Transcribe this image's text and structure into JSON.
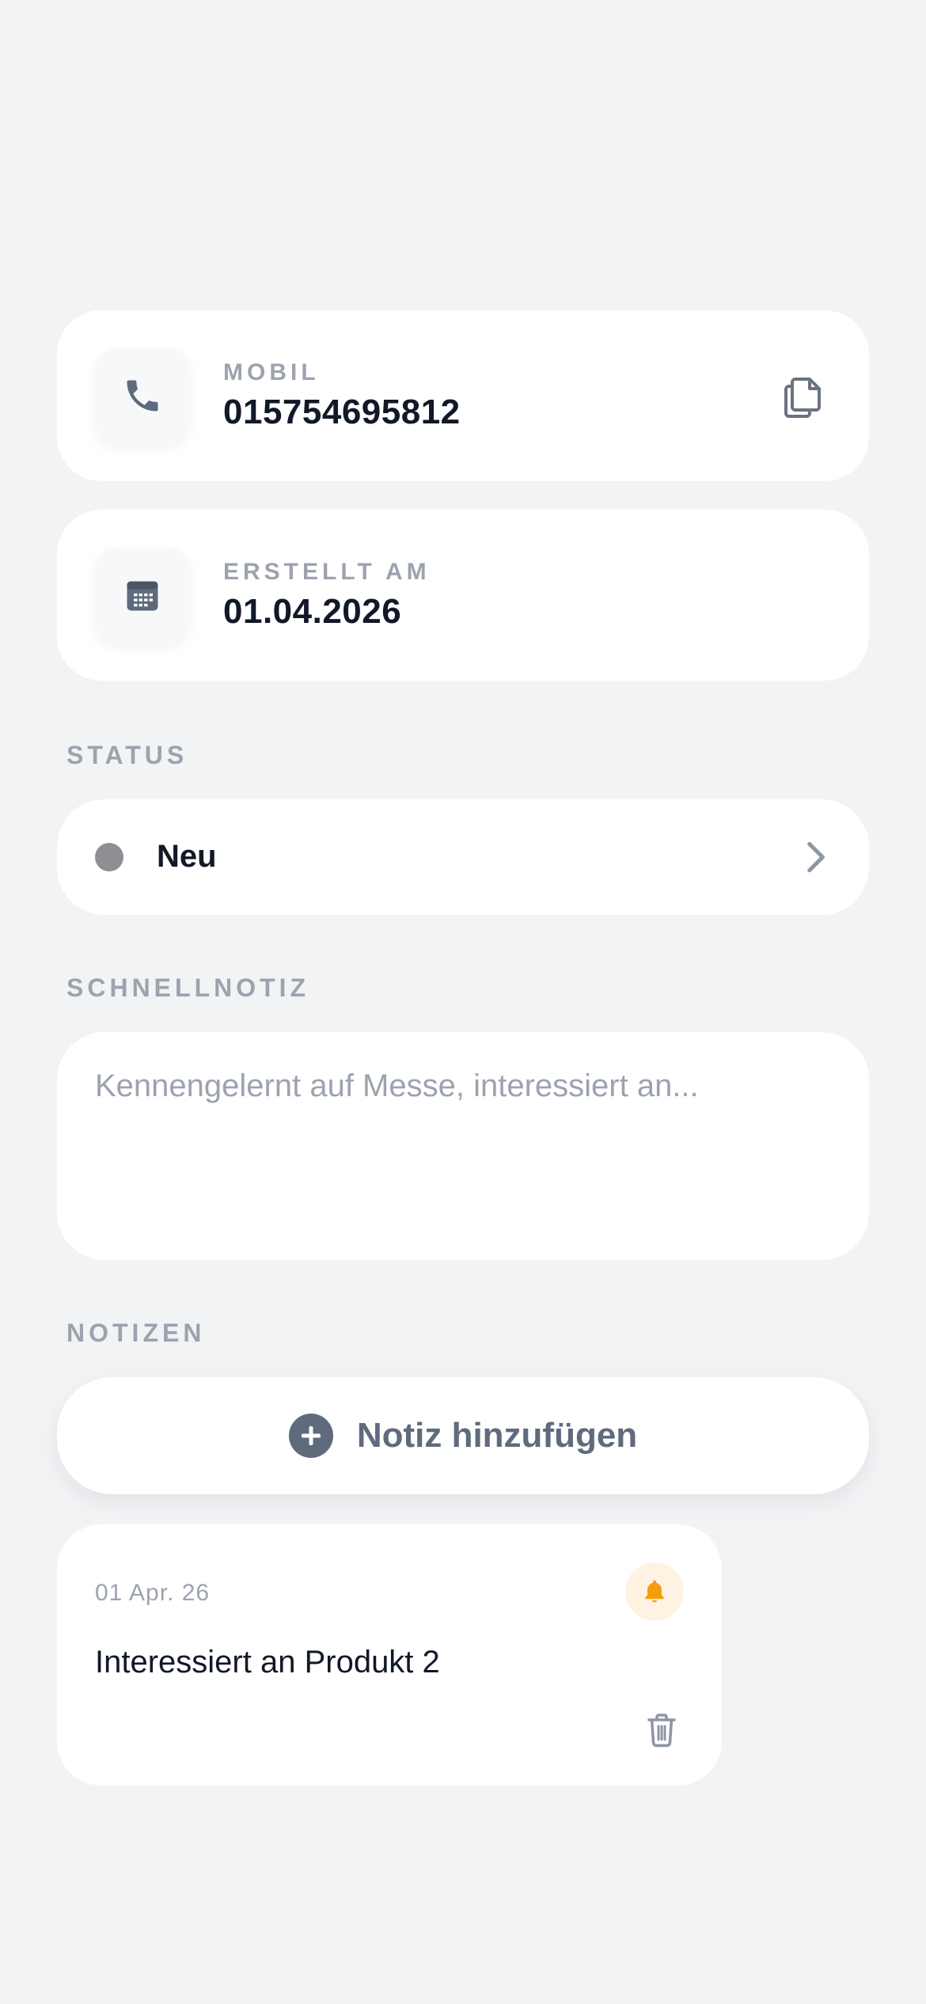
{
  "contact": {
    "mobile": {
      "label": "MOBIL",
      "value": "015754695812",
      "icon": "phone-icon"
    },
    "created": {
      "label": "ERSTELLT AM",
      "value": "01.04.2026",
      "icon": "calendar-icon"
    }
  },
  "status": {
    "section_label": "STATUS",
    "value": "Neu",
    "dot_color": "#8e8e93"
  },
  "quick_note": {
    "section_label": "SCHNELLNOTIZ",
    "placeholder": "Kennengelernt auf Messe, interessiert an...",
    "value": ""
  },
  "notes": {
    "section_label": "NOTIZEN",
    "add_label": "Notiz hinzufügen",
    "items": [
      {
        "date": "01 Apr. 26",
        "text": "Interessiert an Produkt 2",
        "reminder_color": "#f59e0b"
      }
    ]
  },
  "colors": {
    "background": "#f2f3f5",
    "card": "#ffffff",
    "muted": "#9ca3af",
    "icon": "#5f6b7d",
    "accent_orange": "#f59e0b"
  }
}
